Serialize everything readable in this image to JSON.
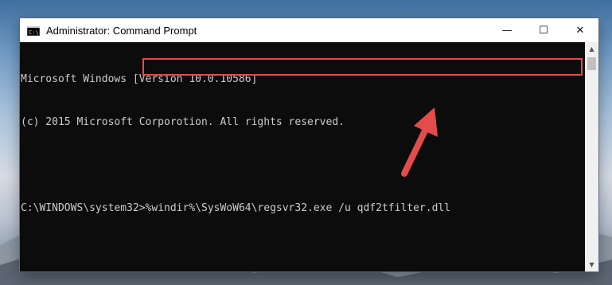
{
  "window": {
    "title": "Administrator: Command Prompt",
    "icon": "cmd-icon"
  },
  "caption_buttons": {
    "minimize": "—",
    "maximize": "☐",
    "close": "✕"
  },
  "console": {
    "line1": "Microsoft Windows [Version 10.0.10586]",
    "line2": "(c) 2015 Microsoft Corporotion. All rights reserved.",
    "line3": "",
    "prompt": "C:\\WINDOWS\\system32>",
    "command": "%windir%\\SysWoW64\\regsvr32.exe /u qdf2tfilter.dll"
  },
  "annotation": {
    "highlight_color": "#e44b4b",
    "arrow_icon": "arrow-pointer-icon"
  },
  "colors": {
    "console_bg": "#0c0c0c",
    "console_text": "#cccccc",
    "titlebar_bg": "#ffffff"
  }
}
